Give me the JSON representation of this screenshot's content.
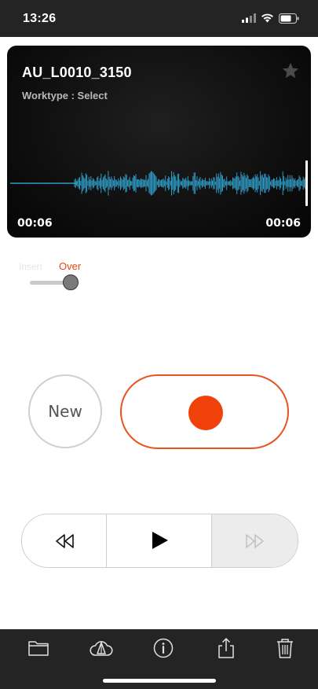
{
  "status_bar": {
    "time": "13:26",
    "icons": [
      "signal-icon",
      "wifi-icon",
      "battery-icon"
    ]
  },
  "recording": {
    "title": "AU_L0010_3150",
    "worktype": "Worktype : Select",
    "elapsed": "00:06",
    "total": "00:06",
    "favorite_icon": "star-icon",
    "waveform_color": "#2f9bc4"
  },
  "record_mode": {
    "insert_label": "Insert",
    "over_label": "Over",
    "selected": "Over"
  },
  "controls": {
    "new_label": "New",
    "record_icon": "record-icon",
    "record_color": "#f0410a"
  },
  "transport": {
    "rewind_icon": "rewind-icon",
    "play_icon": "play-icon",
    "fast_forward_icon": "fast-forward-icon"
  },
  "toolbar": {
    "items": [
      "folder-icon",
      "cloud-sync-icon",
      "info-icon",
      "share-icon",
      "trash-icon"
    ]
  }
}
